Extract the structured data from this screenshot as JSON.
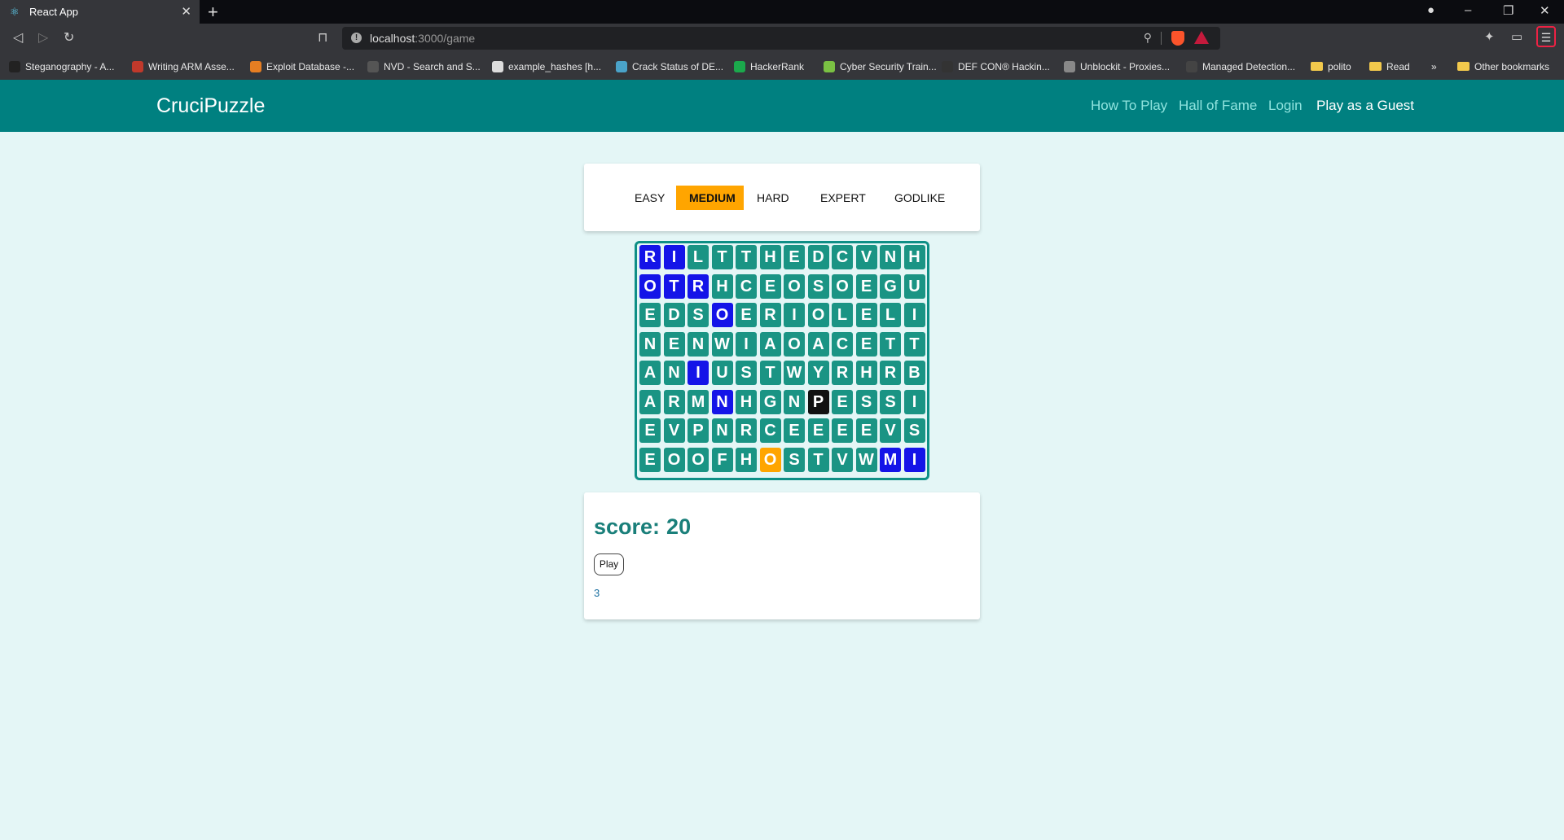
{
  "browser": {
    "tab_title": "React App",
    "tab_icon": "react-icon",
    "url_host": "localhost",
    "url_path": ":3000/game",
    "bookmarks": [
      {
        "label": "Steganography - A...",
        "color": "#222222"
      },
      {
        "label": "Writing ARM Asse...",
        "color": "#c0392b"
      },
      {
        "label": "Exploit Database -...",
        "color": "#e67e22"
      },
      {
        "label": "NVD - Search and S...",
        "color": "#555555"
      },
      {
        "label": "example_hashes [h...",
        "color": "#dddddd"
      },
      {
        "label": "Crack Status of DE...",
        "color": "#4aa3c9"
      },
      {
        "label": "HackerRank",
        "color": "#1ba94c"
      },
      {
        "label": "Cyber Security Train...",
        "color": "#7ac143"
      },
      {
        "label": "DEF CON® Hackin...",
        "color": "#333333"
      },
      {
        "label": "Unblockit - Proxies...",
        "color": "#888888"
      },
      {
        "label": "Managed Detection...",
        "color": "#444444"
      },
      {
        "label": "polito",
        "folder": true
      },
      {
        "label": "Read",
        "folder": true
      }
    ],
    "bookmarks_overflow": "»",
    "other_bookmarks": "Other bookmarks"
  },
  "app": {
    "brand": "CruciPuzzle",
    "nav": {
      "how_to_play": "How To Play",
      "hall_of_fame": "Hall of Fame",
      "login": "Login",
      "guest": "Play as a Guest"
    },
    "levels": [
      "EASY",
      "MEDIUM",
      "HARD",
      "EXPERT",
      "GODLIKE"
    ],
    "active_level": "MEDIUM",
    "grid": [
      [
        "R",
        "I",
        "L",
        "T",
        "T",
        "H",
        "E",
        "D",
        "C",
        "V",
        "N",
        "H"
      ],
      [
        "O",
        "T",
        "R",
        "H",
        "C",
        "E",
        "O",
        "S",
        "O",
        "E",
        "G",
        "U"
      ],
      [
        "E",
        "D",
        "S",
        "O",
        "E",
        "R",
        "I",
        "O",
        "L",
        "E",
        "L",
        "I"
      ],
      [
        "N",
        "E",
        "N",
        "W",
        "I",
        "A",
        "O",
        "A",
        "C",
        "E",
        "T",
        "T"
      ],
      [
        "A",
        "N",
        "I",
        "U",
        "S",
        "T",
        "W",
        "Y",
        "R",
        "H",
        "R",
        "B"
      ],
      [
        "A",
        "R",
        "M",
        "N",
        "H",
        "G",
        "N",
        "P",
        "E",
        "S",
        "S",
        "I"
      ],
      [
        "E",
        "V",
        "P",
        "N",
        "R",
        "C",
        "E",
        "E",
        "E",
        "E",
        "V",
        "S"
      ],
      [
        "E",
        "O",
        "O",
        "F",
        "H",
        "O",
        "S",
        "T",
        "V",
        "W",
        "M",
        "I"
      ]
    ],
    "selected_cells": [
      [
        0,
        0
      ],
      [
        0,
        1
      ],
      [
        1,
        0
      ],
      [
        1,
        1
      ],
      [
        1,
        2
      ],
      [
        2,
        3
      ],
      [
        4,
        2
      ],
      [
        5,
        3
      ],
      [
        7,
        10
      ],
      [
        7,
        11
      ]
    ],
    "current_cell": [
      5,
      7
    ],
    "hint_cell": [
      7,
      5
    ],
    "colors": {
      "navbar": "#008080",
      "cell": "#1a9484",
      "selected": "#1414e8",
      "current": "#111111",
      "hint": "#ffa500",
      "active_level": "#ffa500"
    },
    "score_label": "score:",
    "score_value": "20",
    "play_label": "Play",
    "timer": "3"
  }
}
